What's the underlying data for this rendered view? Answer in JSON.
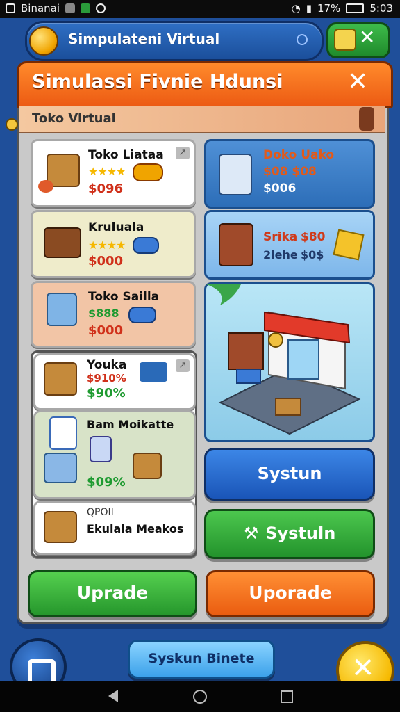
{
  "status_bar": {
    "app_name": "Binanai",
    "time": "5:03",
    "battery": "17%"
  },
  "app_bar": {
    "title": "Simpulateni Virtual"
  },
  "panel": {
    "title": "Simulassi Fivnie Hdunsi",
    "close_label": "✕",
    "subtitle": "Toko Virtual"
  },
  "left_cards": [
    {
      "title": "Toko Liataa",
      "price": "$096"
    },
    {
      "title": "Kruluala",
      "price": "$000"
    },
    {
      "title": "Toko Sailla",
      "price": "$000",
      "sub_price": "$888"
    },
    {
      "title": "Youka",
      "price_red": "$910%",
      "price_green": "$90%"
    },
    {
      "title": "Bam Moikatte",
      "price": "$09%"
    },
    {
      "title": "Ekulaia Meakos",
      "sub": "QPOII"
    }
  ],
  "right_tiles": [
    {
      "title": "Doko Uako",
      "line1": "$08 $08",
      "line2": "$006"
    },
    {
      "title": "Srika",
      "line1": "$80",
      "line2": "2lehe",
      "line3": "$0$"
    }
  ],
  "buttons": {
    "systun_blue": "Systun",
    "systun_green": "Systuln",
    "upgrade_green": "Uprade",
    "upgrade_orange": "Uporade"
  },
  "bottom": {
    "center_button": "Syskun Binete"
  },
  "colors": {
    "background": "#1f4f9a",
    "header_orange": "#ec5a13",
    "green": "#2aa63a",
    "blue": "#1f62c9",
    "orange": "#f06a12"
  },
  "icons": [
    "coin-icon",
    "gift-icon",
    "close-icon",
    "star-icon",
    "box-icon",
    "shop-icon",
    "back-icon",
    "home-icon",
    "recents-icon",
    "tools-icon"
  ]
}
